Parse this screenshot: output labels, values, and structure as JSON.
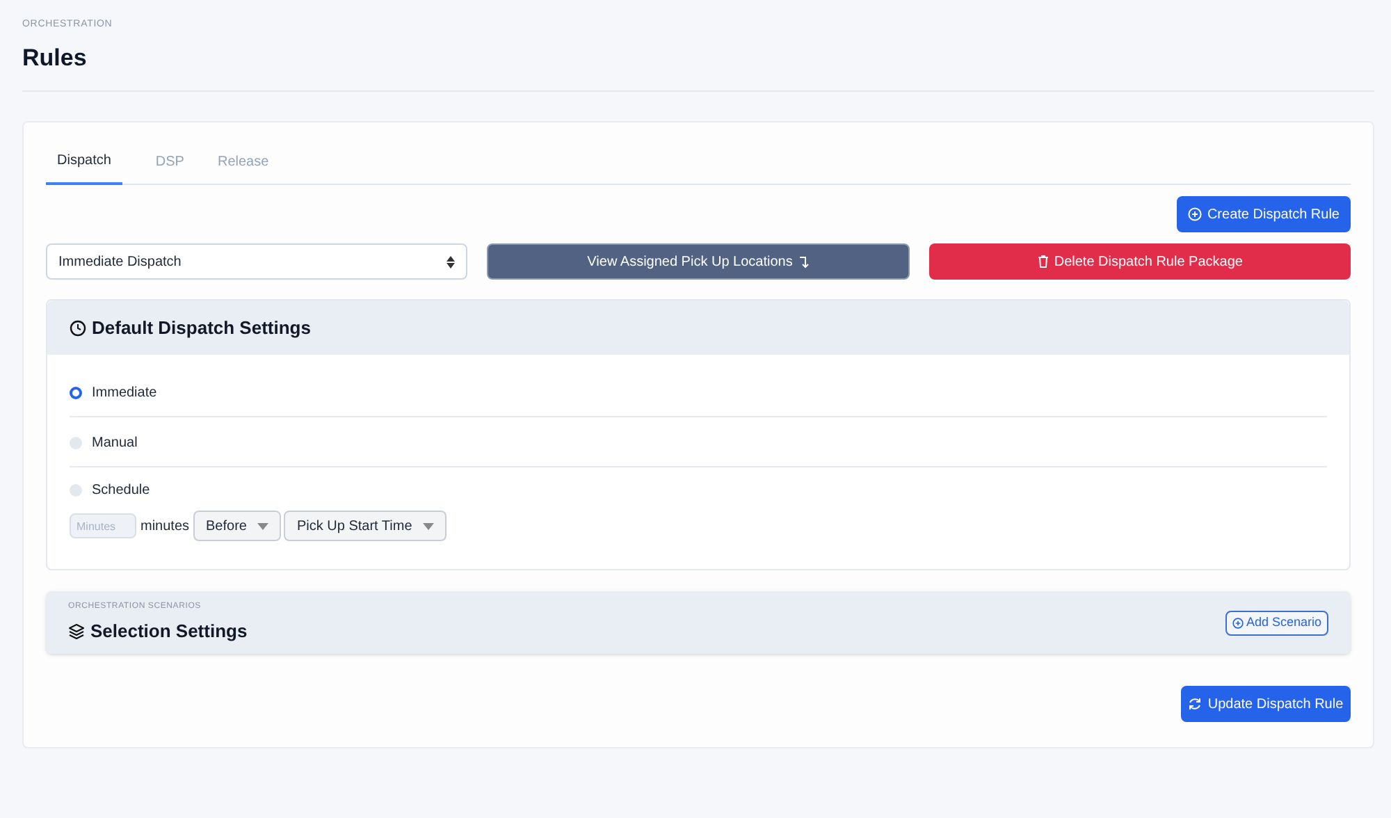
{
  "header": {
    "eyebrow": "ORCHESTRATION",
    "title": "Rules"
  },
  "tabs": [
    {
      "label": "Dispatch",
      "selected": true
    },
    {
      "label": "DSP",
      "selected": false
    },
    {
      "label": "Release",
      "selected": false
    }
  ],
  "create_button": "Create Dispatch Rule",
  "package_select": {
    "value": "Immediate Dispatch"
  },
  "view_button": "View Assigned Pick Up Locations",
  "delete_button": "Delete Dispatch Rule Package",
  "default_settings": {
    "title": "Default Dispatch Settings",
    "options": [
      {
        "label": "Immediate",
        "selected": true
      },
      {
        "label": "Manual",
        "selected": false
      },
      {
        "label": "Schedule",
        "selected": false
      }
    ],
    "schedule": {
      "minutes_placeholder": "Minutes",
      "unit": "minutes",
      "relation": "Before",
      "reference": "Pick Up Start Time"
    }
  },
  "selection_settings": {
    "eyebrow": "ORCHESTRATION SCENARIOS",
    "title": "Selection Settings",
    "add_button": "Add Scenario"
  },
  "update_button": "Update Dispatch Rule"
}
